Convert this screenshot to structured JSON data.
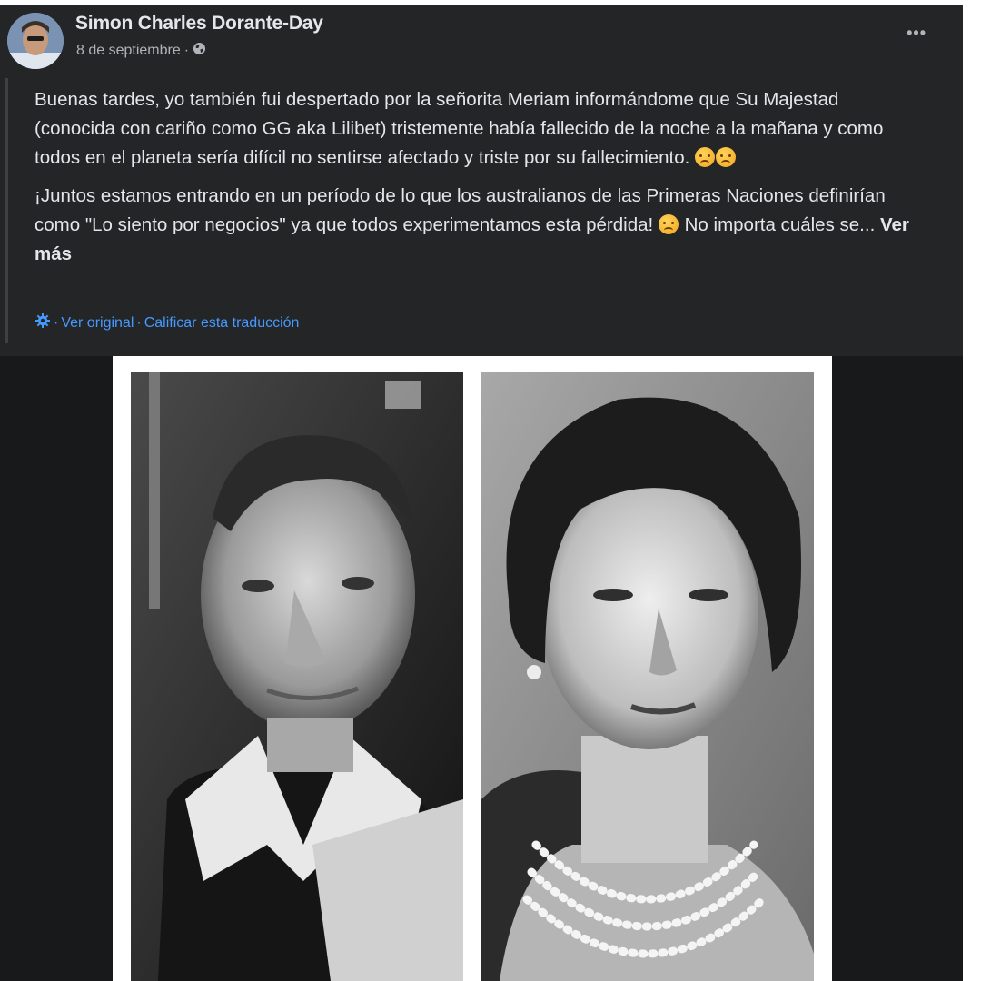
{
  "post": {
    "author": "Simon Charles Dorante-Day",
    "date": "8 de septiembre",
    "privacy_icon": "globe-icon",
    "more_icon": "more-options-icon",
    "more_label": "•••",
    "paragraphs": [
      "Buenas tardes, yo también fui despertado por la señorita Meriam informándome que Su Majestad (conocida con cariño como GG aka Lilibet) tristemente había fallecido de la noche a la mañana y como todos en el planeta sería difícil no sentirse afectado y triste por su fallecimiento.",
      "¡Juntos estamos entrando en un período de lo que los australianos de las Primeras Naciones definirían como \"Lo siento por negocios\" ya que todos experimentamos esta pérdida!",
      "No importa cuáles se..."
    ],
    "see_more": "Ver más",
    "translation": {
      "icon": "gear-icon",
      "separator": "·",
      "view_original": "Ver original",
      "rate_translation": "Calificar esta traducción"
    },
    "colors": {
      "background": "#242526",
      "text": "#e4e6eb",
      "secondary_text": "#b0b3b8",
      "link": "#4599ff"
    }
  }
}
